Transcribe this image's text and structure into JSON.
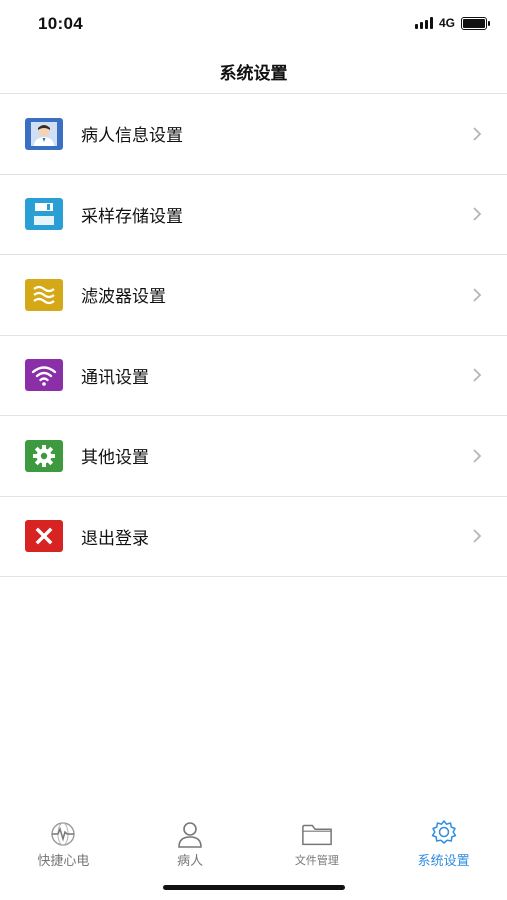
{
  "status_bar": {
    "time": "10:04",
    "network": "4G"
  },
  "nav": {
    "title": "系统设置"
  },
  "menu": {
    "items": [
      {
        "label": "病人信息设置",
        "icon": "doctor-avatar-icon",
        "color": "#3a6fc4"
      },
      {
        "label": "采样存储设置",
        "icon": "floppy-disk-icon",
        "color": "#2a9fd6"
      },
      {
        "label": "滤波器设置",
        "icon": "wave-filter-icon",
        "color": "#d4a817"
      },
      {
        "label": "通讯设置",
        "icon": "wifi-icon",
        "color": "#8a2fa8"
      },
      {
        "label": "其他设置",
        "icon": "gear-icon",
        "color": "#3e9a3e"
      },
      {
        "label": "退出登录",
        "icon": "close-icon",
        "color": "#d82323"
      }
    ]
  },
  "tabs": [
    {
      "label": "快捷心电",
      "icon": "ecg-globe-icon",
      "active": false
    },
    {
      "label": "病人",
      "icon": "person-icon",
      "active": false
    },
    {
      "label": "文件管理",
      "icon": "folder-icon",
      "active": false
    },
    {
      "label": "系统设置",
      "icon": "gear-outline-icon",
      "active": true
    }
  ],
  "colors": {
    "accent": "#2f8ee0",
    "divider": "#e3e3e3",
    "tab_inactive": "#777777"
  }
}
